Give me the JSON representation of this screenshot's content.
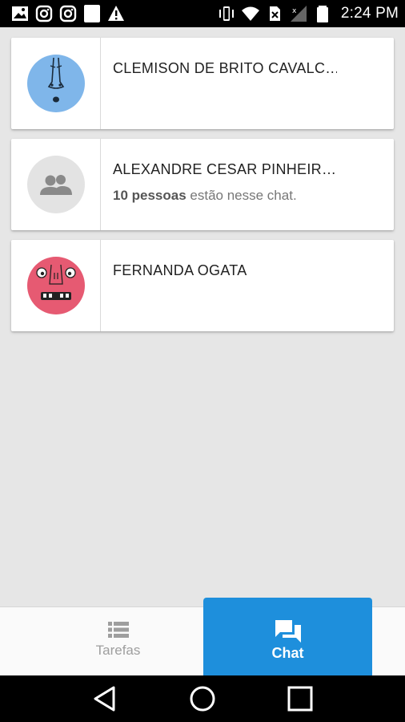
{
  "status_bar": {
    "time": "2:24 PM",
    "left_icons": [
      "image-icon",
      "instagram-icon",
      "instagram-icon",
      "blank-square-icon",
      "warning-icon"
    ],
    "right_icons": [
      "vibrate-icon",
      "wifi-icon",
      "no-sim-icon",
      "signal-icon",
      "battery-icon"
    ]
  },
  "chats": [
    {
      "title": "CLEMISON DE BRITO CAVALC…",
      "subtitle_bold": "",
      "subtitle_rest": "",
      "avatar": "blue-face-avatar",
      "avatar_color": "#7fb6ea"
    },
    {
      "title": "ALEXANDRE CESAR PINHEIR…",
      "subtitle_bold": "10 pessoas",
      "subtitle_rest": " estão nesse chat.",
      "avatar": "group-icon",
      "avatar_color": "#e3e3e3"
    },
    {
      "title": "FERNANDA OGATA",
      "subtitle_bold": "",
      "subtitle_rest": "",
      "avatar": "pink-face-avatar",
      "avatar_color": "#e65a72"
    }
  ],
  "tabs": {
    "tarefas": "Tarefas",
    "chat": "Chat",
    "active": "chat",
    "active_color": "#1e8fdc"
  }
}
